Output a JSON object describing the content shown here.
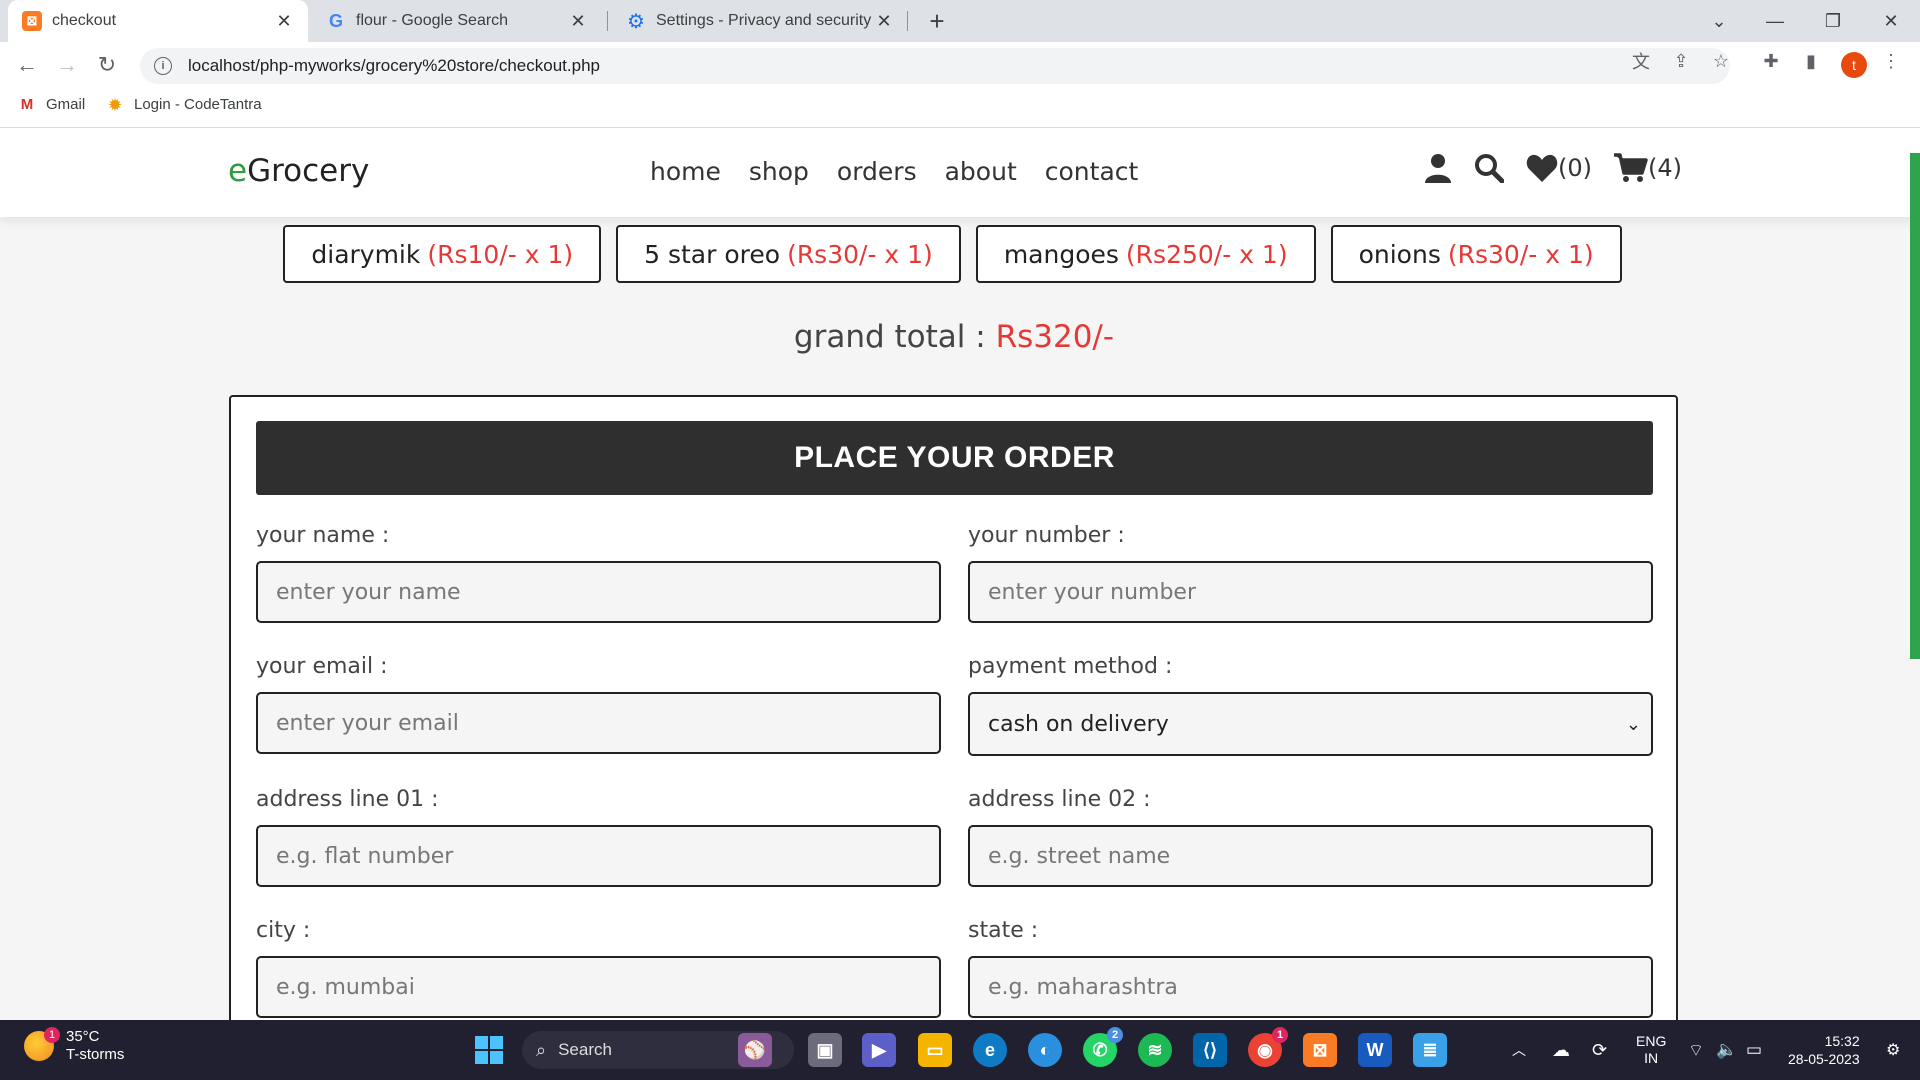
{
  "browser": {
    "tabs": [
      {
        "title": "checkout",
        "icon": "xampp-icon"
      },
      {
        "title": "flour - Google Search",
        "icon": "google-icon"
      },
      {
        "title": "Settings - Privacy and security",
        "icon": "gear-icon"
      }
    ],
    "url": "localhost/php-myworks/grocery%20store/checkout.php",
    "profile_initial": "t",
    "bookmarks": [
      {
        "label": "Gmail",
        "icon": "gmail-icon"
      },
      {
        "label": "Login - CodeTantra",
        "icon": "codetantra-icon"
      }
    ]
  },
  "site": {
    "logo_prefix": "e",
    "logo_rest": "Grocery",
    "nav": [
      "home",
      "shop",
      "orders",
      "about",
      "contact"
    ],
    "wishlist_count": "(0)",
    "cart_count": "(4)"
  },
  "order_items": [
    {
      "name": "diarymik",
      "price": "(Rs10/- x 1)"
    },
    {
      "name": "5 star oreo",
      "price": "(Rs30/- x 1)"
    },
    {
      "name": "mangoes",
      "price": "(Rs250/- x 1)"
    },
    {
      "name": "onions",
      "price": "(Rs30/- x 1)"
    }
  ],
  "grand_total": {
    "label": "grand total : ",
    "amount": "Rs320/-"
  },
  "form": {
    "heading": "PLACE YOUR ORDER",
    "name": {
      "label": "your name :",
      "placeholder": "enter your name"
    },
    "number": {
      "label": "your number :",
      "placeholder": "enter your number"
    },
    "email": {
      "label": "your email :",
      "placeholder": "enter your email"
    },
    "payment": {
      "label": "payment method :",
      "value": "cash on delivery"
    },
    "address1": {
      "label": "address line 01 :",
      "placeholder": "e.g. flat number"
    },
    "address2": {
      "label": "address line 02 :",
      "placeholder": "e.g. street name"
    },
    "city": {
      "label": "city :",
      "placeholder": "e.g. mumbai"
    },
    "state": {
      "label": "state :",
      "placeholder": "e.g. maharashtra"
    }
  },
  "taskbar": {
    "weather_temp": "35°C",
    "weather_desc": "T-storms",
    "weather_badge": "1",
    "search_label": "Search",
    "lang_1": "ENG",
    "lang_2": "IN",
    "time": "15:32",
    "date": "28-05-2023",
    "whatsapp_badge": "2",
    "chrome_badge": "1"
  },
  "colors": {
    "accent_green": "#2e9c3f",
    "price_red": "#e53935",
    "form_head_bg": "#2f2f2f"
  }
}
